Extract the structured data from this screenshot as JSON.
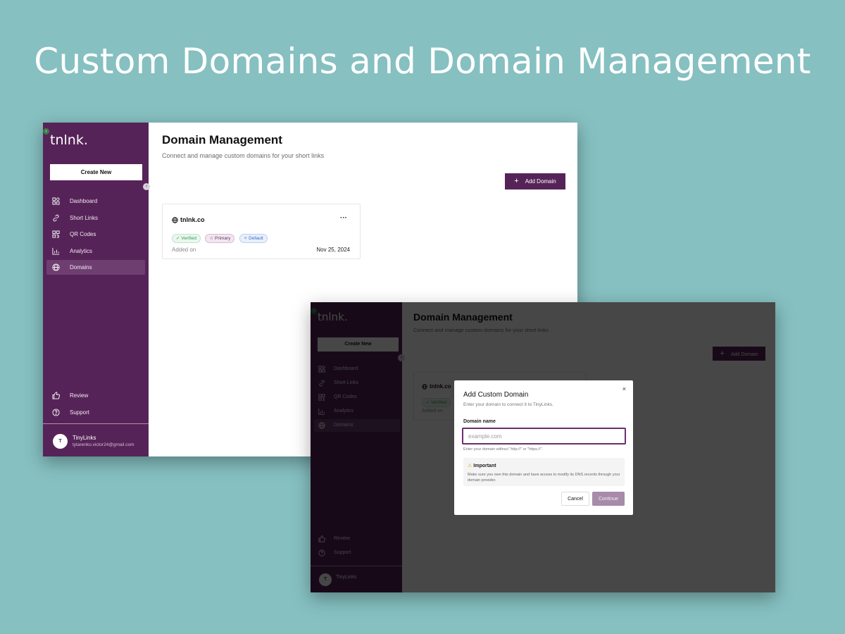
{
  "hero": {
    "title": "Custom Domains and Domain Management"
  },
  "app": {
    "logo": "tnlnk.",
    "create_new": "Create New",
    "nav": [
      {
        "label": "Dashboard",
        "icon": "dashboard-icon"
      },
      {
        "label": "Short Links",
        "icon": "link-icon"
      },
      {
        "label": "QR Codes",
        "icon": "qr-icon"
      },
      {
        "label": "Analytics",
        "icon": "chart-icon"
      },
      {
        "label": "Domains",
        "icon": "globe-icon",
        "active": true
      }
    ],
    "nav_bottom": [
      {
        "label": "Review",
        "icon": "thumbs-up-icon"
      },
      {
        "label": "Support",
        "icon": "help-icon"
      }
    ],
    "user": {
      "initial": "T",
      "name": "TinyLinks",
      "email": "tytarenko.victor24@gmail.com"
    },
    "colors": {
      "sidebar": "#562358",
      "accent": "#562358",
      "background": "#86c0c1"
    }
  },
  "main": {
    "title": "Domain Management",
    "subtitle": "Connect and manage custom domains for your short links",
    "add_button": "Add Domain",
    "domain_card": {
      "name": "tnlnk.co",
      "menu": "···",
      "badges": {
        "verified": "✓ Verified",
        "primary": "☆ Primary",
        "default": "✧ Default"
      },
      "added_label": "Added on",
      "added_date": "Nov 25, 2024"
    }
  },
  "modal": {
    "close": "×",
    "title": "Add Custom Domain",
    "subtitle": "Enter your domain to connect it to TinyLinks.",
    "field_label": "Domain name",
    "placeholder": "example.com",
    "hint": "Enter your domain without \"http://\" or \"https://\".",
    "note_title": "Important",
    "note_text": "Make sure you own this domain and have access to modify its DNS records through your domain provider.",
    "cancel": "Cancel",
    "continue": "Continue"
  }
}
